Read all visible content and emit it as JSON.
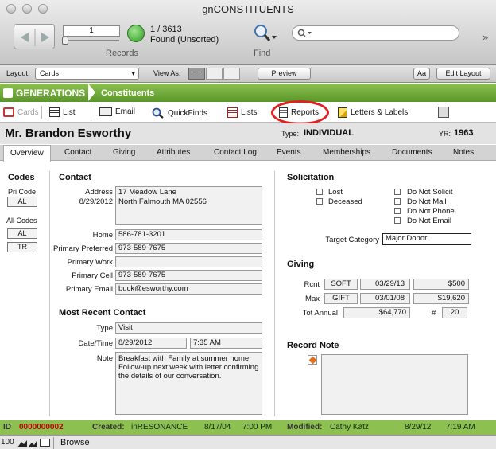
{
  "window": {
    "title": "gnCONSTITUENTS"
  },
  "toolbar": {
    "record_current": "1",
    "record_total": "1 / 3613",
    "found_status": "Found (Unsorted)",
    "records_label": "Records",
    "find_label": "Find"
  },
  "layoutbar": {
    "layout_label": "Layout:",
    "layout_value": "Cards",
    "view_as_label": "View As:",
    "preview_label": "Preview",
    "font_btn": "Aa",
    "edit_layout_label": "Edit Layout"
  },
  "genbar": {
    "app": "GENERATIONS",
    "section": "Constituents"
  },
  "nav": {
    "cards": "Cards",
    "list": "List",
    "email": "Email",
    "quickfinds": "QuickFinds",
    "lists": "Lists",
    "reports": "Reports",
    "letters": "Letters & Labels"
  },
  "header": {
    "name": "Mr. Brandon Esworthy",
    "type_label": "Type:",
    "type_value": "INDIVIDUAL",
    "yr_label": "YR:",
    "yr_value": "1963"
  },
  "tabs": [
    "Overview",
    "Contact",
    "Giving",
    "Attributes",
    "Contact Log",
    "Events",
    "Memberships",
    "Documents",
    "Notes"
  ],
  "codes": {
    "title": "Codes",
    "pri_label": "Pri Code",
    "pri_value": "AL",
    "all_label": "All Codes",
    "all_values": [
      "AL",
      "TR"
    ]
  },
  "contact": {
    "title": "Contact",
    "address_label": "Address",
    "address_date": "8/29/2012",
    "address_line1": "17 Meadow Lane",
    "address_line2": "North Falmouth MA  02556",
    "home_label": "Home",
    "home": "586-781-3201",
    "pref_label": "Primary Preferred",
    "pref": "973-589-7675",
    "work_label": "Primary Work",
    "work": "",
    "cell_label": "Primary Cell",
    "cell": "973-589-7675",
    "email_label": "Primary Email",
    "email": "buck@esworthy.com"
  },
  "recent": {
    "title": "Most Recent Contact",
    "type_label": "Type",
    "type": "Visit",
    "datetime_label": "Date/Time",
    "date": "8/29/2012",
    "time": "7:35 AM",
    "note_label": "Note",
    "note": "Breakfast with Family at summer home. Follow-up next week with letter confirming the details of our conversation."
  },
  "solicitation": {
    "title": "Solicitation",
    "lost": "Lost",
    "deceased": "Deceased",
    "dns": "Do Not Solicit",
    "dnm": "Do Not Mail",
    "dnp": "Do Not Phone",
    "dne": "Do Not Email",
    "target_label": "Target Category",
    "target": "Major Donor"
  },
  "giving": {
    "title": "Giving",
    "rcnt_label": "Rcnt",
    "rcnt_type": "SOFT",
    "rcnt_date": "03/29/13",
    "rcnt_amount": "$500",
    "max_label": "Max",
    "max_type": "GIFT",
    "max_date": "03/01/08",
    "max_amount": "$19,620",
    "total_label": "Tot Annual",
    "total": "$64,770",
    "count_label": "#",
    "count": "20"
  },
  "recordnote": {
    "title": "Record Note"
  },
  "footer": {
    "id_label": "ID",
    "id": "0000000002",
    "created_label": "Created:",
    "created_by": "inRESONANCE",
    "created_date": "8/17/04",
    "created_time": "7:00 PM",
    "modified_label": "Modified:",
    "modified_by": "Cathy Katz",
    "modified_date": "8/29/12",
    "modified_time": "7:19 AM"
  },
  "status": {
    "zoom": "100",
    "mode": "Browse"
  },
  "colors": {
    "green": "#8cc152",
    "id_red": "#c00000",
    "highlight": "#e02020"
  }
}
